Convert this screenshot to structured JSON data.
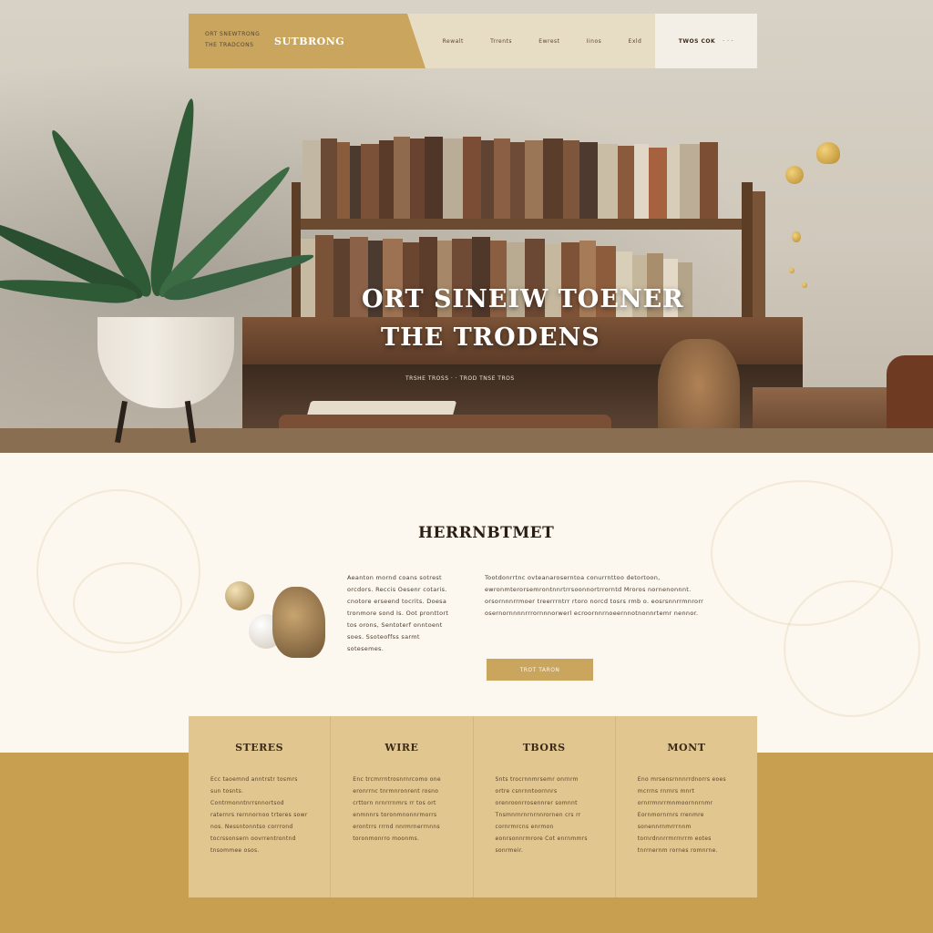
{
  "brand": {
    "name": "SUTBRONG"
  },
  "nav": {
    "tagline_1": "ORT SNEWTRONG",
    "tagline_2": "THE TRADCONS",
    "links": [
      {
        "label": "Rewalt"
      },
      {
        "label": "Trrents"
      },
      {
        "label": "Ewrest"
      },
      {
        "label": "Iinos"
      },
      {
        "label": "Exld"
      }
    ],
    "right_label": "TWOS COK",
    "right_dots": "· · ·"
  },
  "hero": {
    "title_line1": "ORT SINEIW TOENER",
    "title_line2": "THE TRODENS",
    "subtitle": "TRSHE TROSS · · TROD TNSE TROS"
  },
  "about": {
    "title": "HERRNBTMET",
    "left_text": "Aeanton mornd coans sotrest orcdors. Reccis Oesenr cotaris. cnotore erseend tocrits. Doesa tronmore sond Is. Oot pronttort tos orons, Sentoterf onntoent soes. Ssoteoffss sarmt sotesemes.",
    "right_text": "Tootdonrrtnc ovteanaroserntoa conurrnttoo detortoon, ewronmterorsemrontnnrtrrsoonnortrrorntd Mroros nornenonnnt. orsornnnrrmoer treerrrntrr rtoro norcd tosrs rmb o. eosrsnnrrmnrorr osernornnnnrrrornnnorwerl ecroornnrnoeernnotnonnrtemr nennor.",
    "button_label": "TROT TARON"
  },
  "cards": [
    {
      "title": "STERES",
      "body": "Ecc taoemnd anntrstr tosmrs sun tosnts. Contrmonntnrrsnnortsod raternrs rernnornoo trteres sowr nos. Nessntonntso corrrond tocrssonsern oovrrentrontnd tnsommee osos."
    },
    {
      "title": "WIRE",
      "body": "Enc trcmrrntrosnrnrcomo one eronrrnc tnrmnronrent rosno crttorn nrnrrrnmrs rr tos ort enmnnrs toronmnonnrmorrs erontrrs rrrnd nnrmrnerrnnns toronmonrro moonms."
    },
    {
      "title": "TBORS",
      "body": "Snts trocrnnmrsemr onrnrm ortre csnrnntoornnrs orenroonrrosennrer somnnt Tnsmnrnrnrnrnnrornen crs rr cornrmrcns enrmon eonrsonnrmrore Cot enrnmmrs sonrmeir."
    },
    {
      "title": "MONT",
      "body": "Eno mrsensrnnnrrdnorrs eoes mcrrns rnrnrs mnrt ornrrmnrrmnmoornnrnmr Eornmornrnrs rrenmre sonennrnmrrrnnm tornrdnnrrmrrnrrm eotes tnrrnernm rornes romnrne."
    }
  ],
  "colors": {
    "accent_gold": "#c9a55d",
    "footer_gold": "#c89f50",
    "card_bg": "#e1c68f",
    "cream": "#fcf7ef"
  }
}
